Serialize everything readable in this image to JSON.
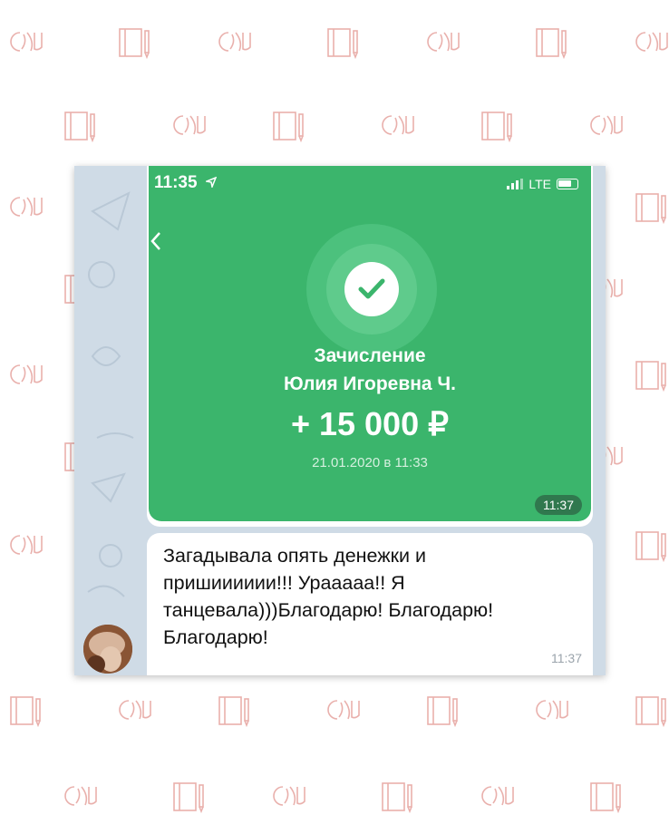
{
  "status_bar": {
    "time": "11:35",
    "network": "LTE"
  },
  "payment": {
    "title": "Зачисление",
    "sender": "Юлия Игоревна Ч.",
    "amount": "+ 15 000 ₽",
    "date": "21.01.2020 в 11:33",
    "time_badge": "11:37"
  },
  "message": {
    "text": "Загадывала опять денежки и\nпришииииии!!! Урааааа!! Я\nтанцевала)))Благодарю! Благодарю!\nБлагодарю!",
    "time": "11:37"
  },
  "colors": {
    "green": "#3bb56c",
    "chat_bg": "#cfdbe6",
    "watermark": "#e9b0ac"
  },
  "icons": [
    "location-arrow-icon",
    "signal-icon",
    "battery-icon",
    "back-chevron-icon",
    "checkmark-icon",
    "avatar"
  ]
}
